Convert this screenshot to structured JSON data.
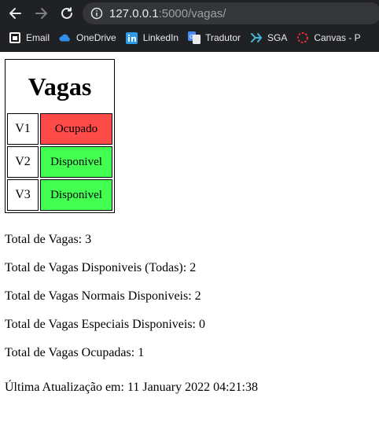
{
  "browser": {
    "url_host": "127.0.0.1",
    "url_path": ":5000/vagas/",
    "bookmarks": [
      {
        "label": "Email",
        "icon": "ms-office-icon"
      },
      {
        "label": "OneDrive",
        "icon": "onedrive-cloud-icon"
      },
      {
        "label": "LinkedIn",
        "icon": "linkedin-icon"
      },
      {
        "label": "Tradutor",
        "icon": "translate-icon"
      },
      {
        "label": "SGA",
        "icon": "sga-icon"
      },
      {
        "label": "Canvas - P",
        "icon": "canvas-icon"
      }
    ]
  },
  "page": {
    "title": "Vagas",
    "spots": [
      {
        "id": "V1",
        "status": "Ocupado",
        "color": "#ff4a4a"
      },
      {
        "id": "V2",
        "status": "Disponivel",
        "color": "#42ff52"
      },
      {
        "id": "V3",
        "status": "Disponivel",
        "color": "#42ff52"
      }
    ],
    "stats": {
      "total": "Total de Vagas: 3",
      "available_all": "Total de Vagas Disponiveis (Todas): 2",
      "available_normal": "Total de Vagas Normais Disponiveis: 2",
      "available_special": "Total de Vagas Especiais Disponiveis: 0",
      "occupied": "Total de Vagas Ocupadas: 1"
    },
    "last_update": "Última Atualização em: 11 January 2022 04:21:38"
  }
}
